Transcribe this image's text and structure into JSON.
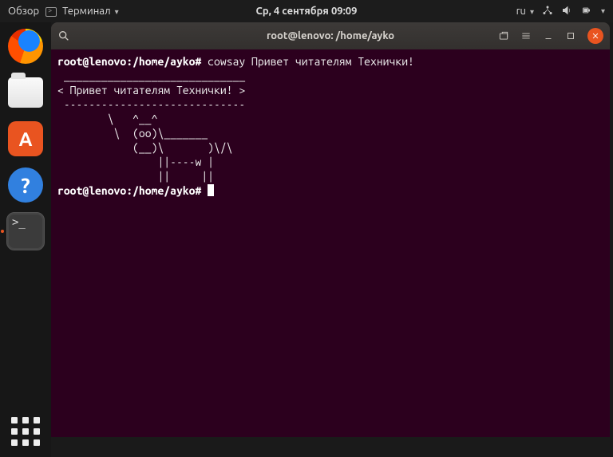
{
  "panel": {
    "activities": "Обзор",
    "app_menu": "Терминал",
    "clock": "Ср, 4 сентября  09:09",
    "lang": "ru"
  },
  "dock": {
    "firefox": "Firefox",
    "files": "Файлы",
    "software": "A",
    "help": "?",
    "terminal": ">_",
    "apps": "Приложения"
  },
  "terminal": {
    "title": "root@lenovo: /home/ayko",
    "output": " _____________________________\n< Привет читателям Технички! >\n -----------------------------\n        \\   ^__^\n         \\  (oo)\\_______\n            (__)\\       )\\/\\\n                ||----w |\n                ||     ||",
    "prompt1": "root@lenovo:/home/ayko#",
    "cmd1": " cowsay Привет читателям Технички!",
    "prompt2": "root@lenovo:/home/ayko#"
  }
}
